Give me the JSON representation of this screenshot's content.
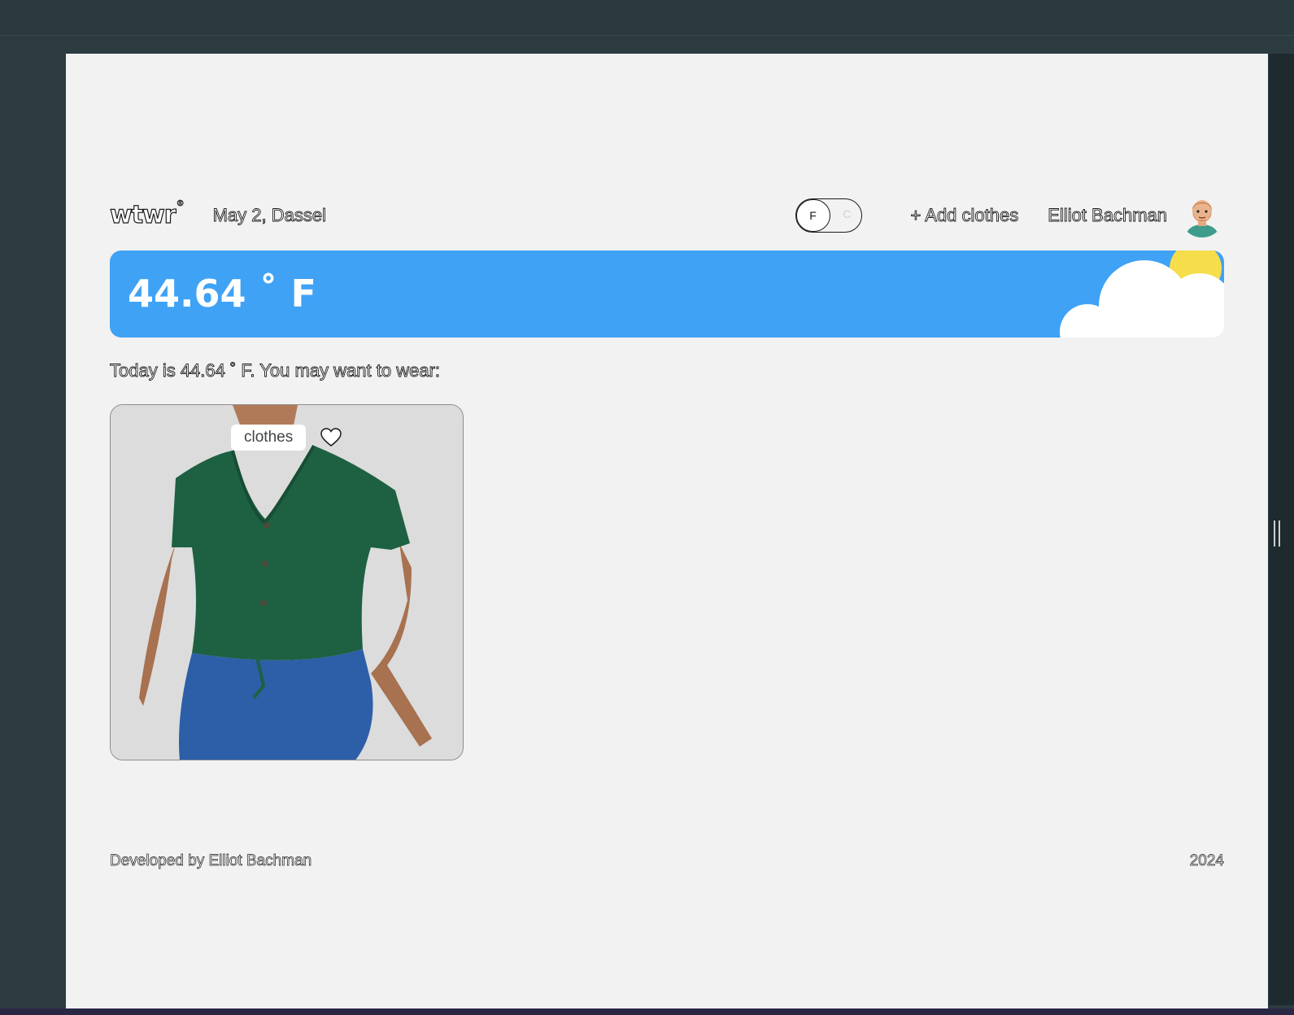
{
  "header": {
    "logo": "wtwr",
    "logo_mark": "®",
    "date_location": "May 2, Dassel",
    "unit_toggle": {
      "active": "F",
      "inactive": "C"
    },
    "add_clothes_label": "+ Add clothes",
    "user_name": "Elliot Bachman"
  },
  "weather": {
    "temperature": "44.64 ˚ F",
    "condition": "cloudy-sunny"
  },
  "main": {
    "suggestion": "Today is 44.64 ˚ F. You may want to wear:",
    "cards": [
      {
        "label": "clothes",
        "image": "green-button-top",
        "liked": false
      }
    ]
  },
  "footer": {
    "credit": "Developed by Elliot Bachman",
    "year": "2024"
  },
  "colors": {
    "weather_bg": "#3fa2f5",
    "sun": "#f6dd4a",
    "page_bg": "#f2f2f2",
    "frame_bg": "#2c3b40"
  }
}
